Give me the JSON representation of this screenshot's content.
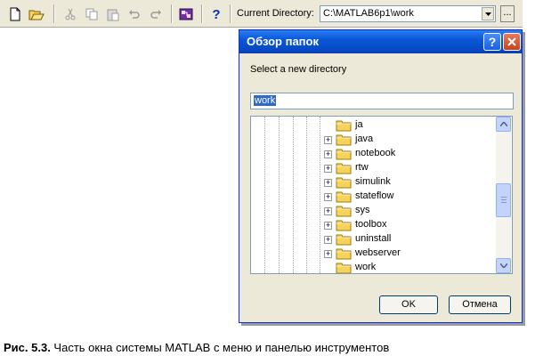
{
  "toolbar": {
    "icons": [
      "new-file-icon",
      "open-file-icon",
      "cut-icon",
      "copy-icon",
      "paste-icon",
      "undo-icon",
      "redo-icon",
      "simulink-icon",
      "help-icon"
    ],
    "current_directory_label": "Current Directory:",
    "current_directory_value": "C:\\MATLAB6p1\\work",
    "browse_label": "..."
  },
  "dialog": {
    "title": "Обзор папок",
    "help_label": "?",
    "prompt": "Select a new directory",
    "name_value": "work",
    "tree_items": [
      {
        "label": "ja",
        "expandable": false
      },
      {
        "label": "java",
        "expandable": true
      },
      {
        "label": "notebook",
        "expandable": true
      },
      {
        "label": "rtw",
        "expandable": true
      },
      {
        "label": "simulink",
        "expandable": true
      },
      {
        "label": "stateflow",
        "expandable": true
      },
      {
        "label": "sys",
        "expandable": true
      },
      {
        "label": "toolbox",
        "expandable": true
      },
      {
        "label": "uninstall",
        "expandable": true
      },
      {
        "label": "webserver",
        "expandable": true
      },
      {
        "label": "work",
        "expandable": false
      }
    ],
    "ok_label": "OK",
    "cancel_label": "Отмена",
    "colors": {
      "title_bar": "#0a58d6",
      "selection": "#316ac5",
      "folder": "#f7d35c"
    }
  },
  "caption": {
    "figure_label": "Рис. 5.3.",
    "text": " Часть окна системы MATLAB с меню и панелью инструментов"
  }
}
